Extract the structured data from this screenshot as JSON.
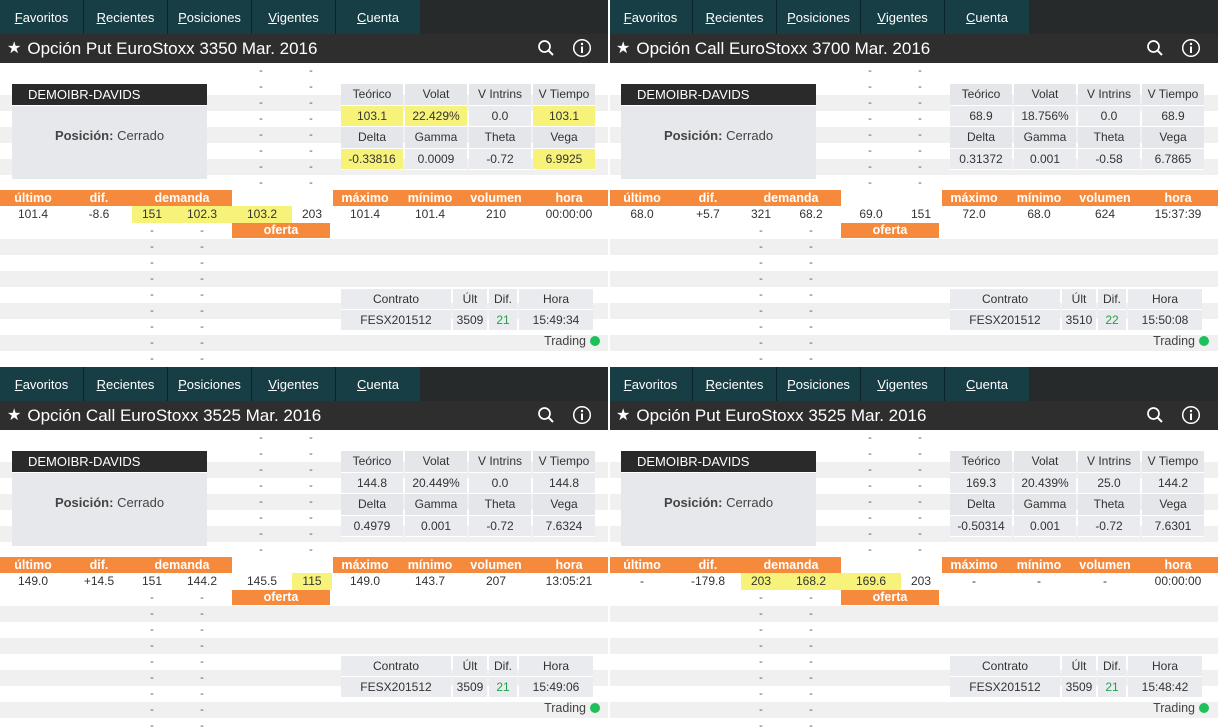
{
  "nav": {
    "tabs": [
      {
        "u": "F",
        "rest": "avoritos"
      },
      {
        "u": "R",
        "rest": "ecientes"
      },
      {
        "u": "P",
        "rest": "osiciones"
      },
      {
        "u": "V",
        "rest": "igentes"
      },
      {
        "u": "C",
        "rest": "uenta"
      }
    ]
  },
  "common": {
    "account": "DEMOIBR-DAVIDS",
    "position_label": "Posición:",
    "position_value": "Cerrado",
    "greeks_headers_1": [
      "Teórico",
      "Volat",
      "V Intrins",
      "V Tiempo"
    ],
    "greeks_headers_2": [
      "Delta",
      "Gamma",
      "Theta",
      "Vega"
    ],
    "book_headers": [
      "último",
      "dif.",
      "demanda"
    ],
    "stats_headers": [
      "máximo",
      "mínimo",
      "volumen",
      "hora"
    ],
    "oferta_label": "oferta",
    "contract_headers": [
      "Contrato",
      "Últ",
      "Dif.",
      "Hora"
    ],
    "trading_label": "Trading",
    "dash": "-",
    "star_icon": "star-icon",
    "search_icon": "search-icon",
    "info_icon": "info-icon"
  },
  "panels": [
    {
      "title": "Opción Put EuroStoxx 3350 Mar. 2016",
      "greeks_1": [
        "103.1",
        "22.429%",
        "0.0",
        "103.1"
      ],
      "greeks_2": [
        "-0.33816",
        "0.0009",
        "-0.72",
        "6.9925"
      ],
      "quote": {
        "ultimo": "101.4",
        "dif": "-8.6",
        "dem_qty": "151",
        "dem_price": "102.3",
        "ofe_price": "103.2",
        "ofe_qty": "203",
        "maximo": "101.4",
        "minimo": "101.4",
        "volumen": "210",
        "hora": "00:00:00"
      },
      "contract": {
        "name": "FESX201512",
        "ult": "3509",
        "dif": "21",
        "hora": "15:49:34"
      }
    },
    {
      "title": "Opción Call EuroStoxx 3700 Mar. 2016",
      "greeks_1": [
        "68.9",
        "18.756%",
        "0.0",
        "68.9"
      ],
      "greeks_2": [
        "0.31372",
        "0.001",
        "-0.58",
        "6.7865"
      ],
      "quote": {
        "ultimo": "68.0",
        "dif": "+5.7",
        "dem_qty": "321",
        "dem_price": "68.2",
        "ofe_price": "69.0",
        "ofe_qty": "151",
        "maximo": "72.0",
        "minimo": "68.0",
        "volumen": "624",
        "hora": "15:37:39"
      },
      "contract": {
        "name": "FESX201512",
        "ult": "3510",
        "dif": "22",
        "hora": "15:50:08"
      }
    },
    {
      "title": "Opción Call EuroStoxx 3525 Mar. 2016",
      "greeks_1": [
        "144.8",
        "20.449%",
        "0.0",
        "144.8"
      ],
      "greeks_2": [
        "0.4979",
        "0.001",
        "-0.72",
        "7.6324"
      ],
      "quote": {
        "ultimo": "149.0",
        "dif": "+14.5",
        "dem_qty": "151",
        "dem_price": "144.2",
        "ofe_price": "145.5",
        "ofe_qty": "115",
        "maximo": "149.0",
        "minimo": "143.7",
        "volumen": "207",
        "hora": "13:05:21"
      },
      "contract": {
        "name": "FESX201512",
        "ult": "3509",
        "dif": "21",
        "hora": "15:49:06"
      }
    },
    {
      "title": "Opción Put EuroStoxx 3525 Mar. 2016",
      "greeks_1": [
        "169.3",
        "20.439%",
        "25.0",
        "144.2"
      ],
      "greeks_2": [
        "-0.50314",
        "0.001",
        "-0.72",
        "7.6301"
      ],
      "quote": {
        "ultimo": "-",
        "dif": "-179.8",
        "dem_qty": "203",
        "dem_price": "168.2",
        "ofe_price": "169.6",
        "ofe_qty": "203",
        "maximo": "-",
        "minimo": "-",
        "volumen": "-",
        "hora": "00:00:00"
      },
      "contract": {
        "name": "FESX201512",
        "ult": "3509",
        "dif": "21",
        "hora": "15:48:42"
      }
    }
  ]
}
